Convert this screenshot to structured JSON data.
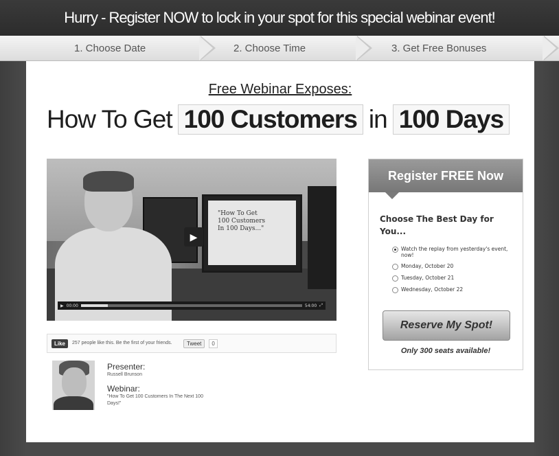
{
  "banner": {
    "text": "Hurry - Register NOW to lock in your spot for this special webinar event!"
  },
  "steps": [
    {
      "label": "1. Choose Date"
    },
    {
      "label": "2. Choose Time"
    },
    {
      "label": "3. Get Free Bonuses"
    }
  ],
  "hero": {
    "subhead": "Free Webinar Exposes:",
    "headline_prefix": "How To Get",
    "headline_box1": "100 Customers",
    "headline_mid": "in",
    "headline_box2": "100 Days"
  },
  "video": {
    "slide_text": "\"How To Get\n100 Customers\nIn 100 Days...\"",
    "progress_percent": 12,
    "play_icon": "play-icon",
    "time_current": "00:00",
    "time_total": "54:00"
  },
  "social": {
    "like_label": "Like",
    "like_text": "257 people like this. Be the first of your friends.",
    "tweet_label": "Tweet",
    "tweet_count": "0"
  },
  "presenter": {
    "presenter_label": "Presenter:",
    "presenter_name": "Russell Brunson",
    "webinar_label": "Webinar:",
    "webinar_title": "\"How To Get 100 Customers In The Next 100 Days!\""
  },
  "register": {
    "heading": "Register FREE Now",
    "question": "Choose The Best Day for You...",
    "options": [
      {
        "label": "Watch the replay from yesterday's event, now!",
        "selected": true
      },
      {
        "label": "Monday, October 20",
        "selected": false
      },
      {
        "label": "Tuesday, October 21",
        "selected": false
      },
      {
        "label": "Wednesday, October 22",
        "selected": false
      }
    ],
    "button_label": "Reserve My Spot!",
    "seats_text": "Only 300 seats available!"
  }
}
